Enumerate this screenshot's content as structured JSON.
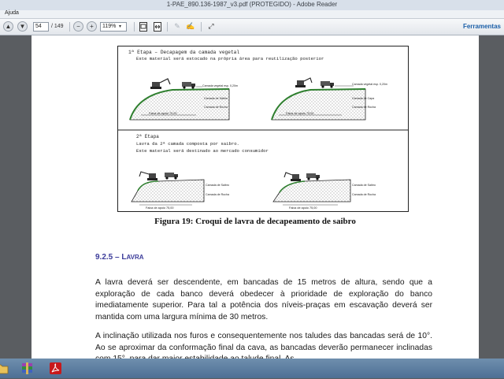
{
  "window": {
    "title": "1-PAE_890.136-1987_v3.pdf (PROTEGIDO) - Adobe Reader",
    "menu_help": "Ajuda"
  },
  "toolbar": {
    "page_current": "54",
    "page_total": "/ 149",
    "zoom": "119%",
    "tools_label": "Ferramentas"
  },
  "figure": {
    "stage1_title": "1ª Etapa – Decapagem da camada vegetal",
    "stage1_desc": "Este material será estocado na própria área para reutilização posterior",
    "stage2_title": "2ª Etapa",
    "stage2_desc1": "Lavra da 2ª camada composta por saibro.",
    "stage2_desc2": "Este material será destinado ao mercado consumidor",
    "label_vegetal": "Camada vegetal esp. 0,20m",
    "label_saibro": "Camada de Saibro",
    "label_rocha": "Camada de Rocha",
    "label_capa": "Camada de Capa",
    "label_faixa": "Faixa de apoio 75,00"
  },
  "document": {
    "caption": "Figura 19: Croqui de lavra de decapeamento de saibro",
    "section_num": "9.2.5 – L",
    "section_rest": "AVRA",
    "para1": "A lavra deverá ser descendente, em bancadas de 15 metros de altura, sendo que a exploração de cada banco deverá obedecer à prioridade de exploração do banco imediatamente superior. Para tal a potência dos níveis-praças em escavação deverá ser mantida com uma largura mínima de 30 metros.",
    "para2": "A inclinação utilizada nos furos e consequentemente nos taludes das bancadas será de 10°. Ao se aproximar da conformação final da cava, as bancadas deverão permanecer inclinadas com 15°, para dar maior estabilidade ao talude final. As"
  },
  "colors": {
    "section_heading": "#3c3c9a",
    "taskbar": "#4d6f94",
    "tools_link": "#1b5fa8"
  },
  "taskbar": {
    "icons": [
      "folder-icon",
      "winrar-icon",
      "adobe-reader-icon"
    ]
  }
}
